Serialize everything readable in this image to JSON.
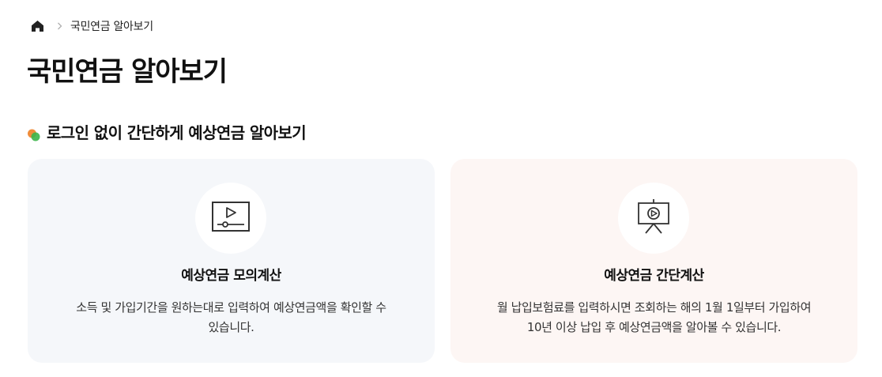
{
  "breadcrumb": {
    "home_icon": "home-icon",
    "separator_icon": "chevron-right-icon",
    "current": "국민연금 알아보기"
  },
  "page": {
    "title": "국민연금 알아보기"
  },
  "section": {
    "icon": "overlapping-circles-icon",
    "heading": "로그인 없이 간단하게 예상연금 알아보기"
  },
  "cards": [
    {
      "icon": "video-player-icon",
      "title": "예상연금 모의계산",
      "description_line1": "소득 및 가입기간을 원하는대로 입력하여 예상연금액을 확인할 수",
      "description_line2": "있습니다.",
      "background": "#f5f7fa"
    },
    {
      "icon": "presentation-board-icon",
      "title": "예상연금 간단계산",
      "description_line1": "월 납입보험료를 입력하시면 조회하는 해의 1월 1일부터 가입하여",
      "description_line2": "10년 이상 납입 후 예상연금액을 알아볼 수 있습니다.",
      "background": "#fdf6f4"
    }
  ],
  "colors": {
    "accent_orange": "#f08c3a",
    "accent_green": "#3bb54a",
    "text": "#111111"
  }
}
